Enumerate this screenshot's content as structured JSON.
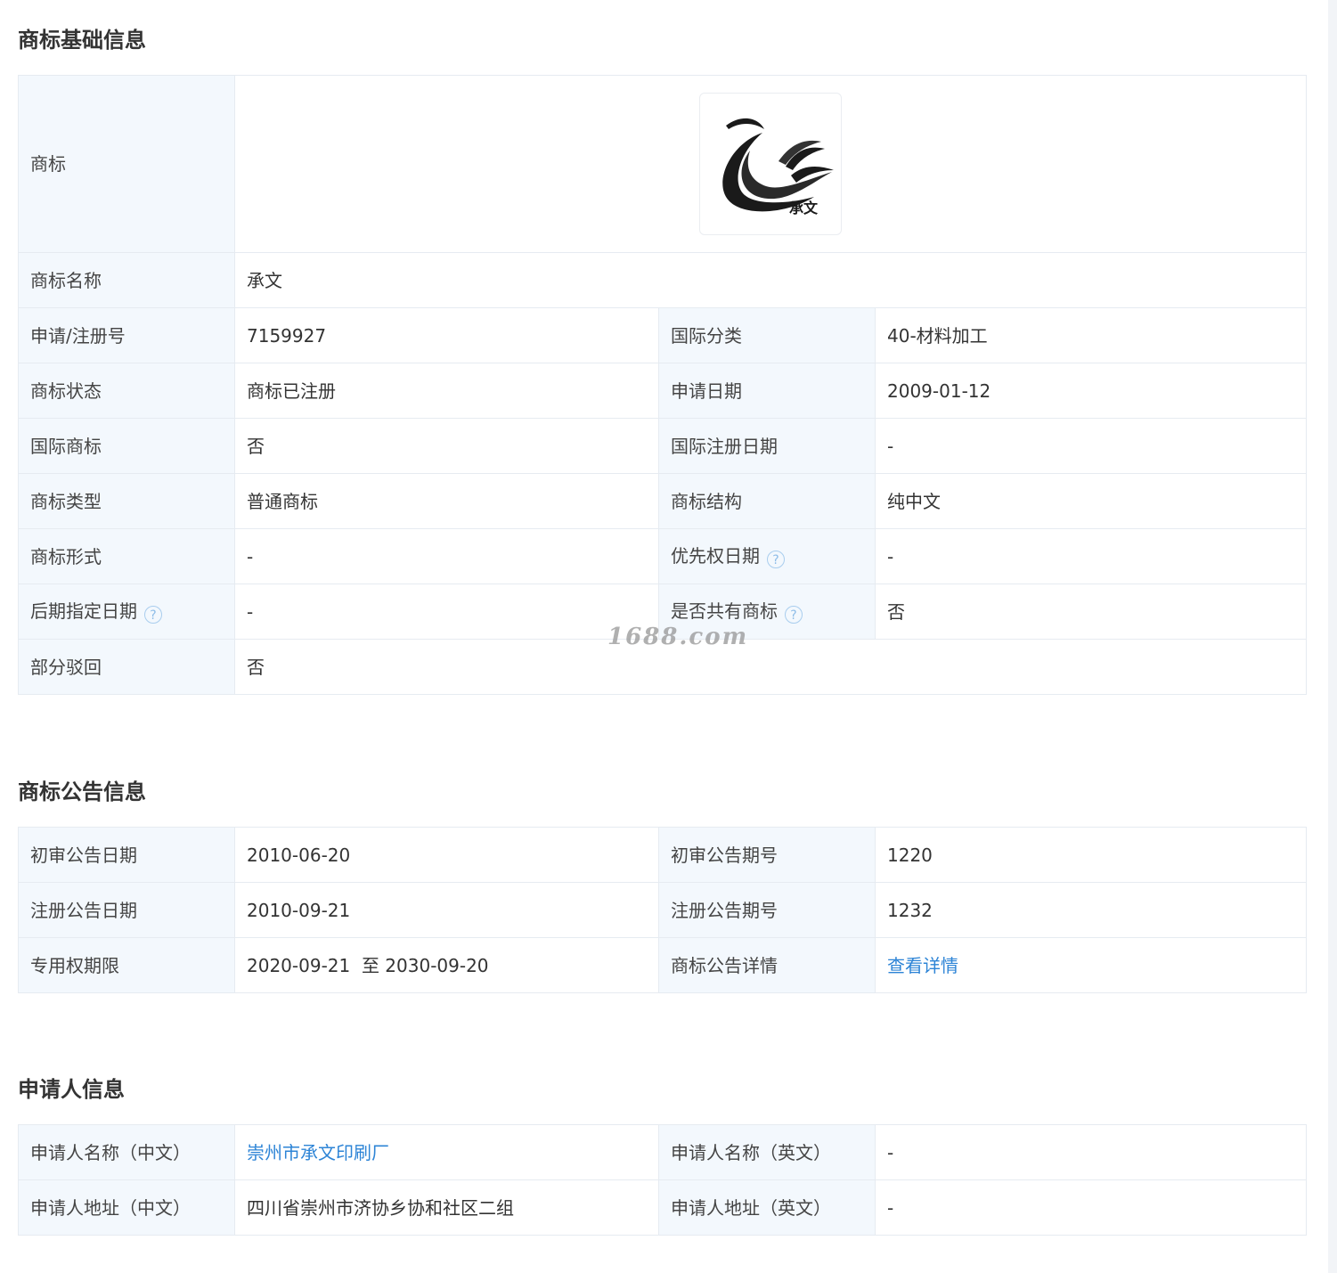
{
  "basic": {
    "title": "商标基础信息",
    "logo_label": "商标",
    "logo_text": "承文",
    "name_label": "商标名称",
    "name_value": "承文",
    "rows": [
      {
        "l1": "申请/注册号",
        "v1": "7159927",
        "l2": "国际分类",
        "v2": "40-材料加工"
      },
      {
        "l1": "商标状态",
        "v1": "商标已注册",
        "l2": "申请日期",
        "v2": "2009-01-12"
      },
      {
        "l1": "国际商标",
        "v1": "否",
        "l2": "国际注册日期",
        "v2": "-"
      },
      {
        "l1": "商标类型",
        "v1": "普通商标",
        "l2": "商标结构",
        "v2": "纯中文"
      },
      {
        "l1": "商标形式",
        "v1": "-",
        "l2": "优先权日期",
        "v2": "-"
      },
      {
        "l1": "后期指定日期",
        "v1": "-",
        "l2": "是否共有商标",
        "v2": "否"
      }
    ],
    "partial_label": "部分驳回",
    "partial_value": "否",
    "help_icon": "?"
  },
  "notice": {
    "title": "商标公告信息",
    "rows": [
      {
        "l1": "初审公告日期",
        "v1": "2010-06-20",
        "l2": "初审公告期号",
        "v2": "1220"
      },
      {
        "l1": "注册公告日期",
        "v1": "2010-09-21",
        "l2": "注册公告期号",
        "v2": "1232"
      },
      {
        "l1": "专用权期限",
        "v1": "2020-09-21  至 2030-09-20",
        "l2": "商标公告详情",
        "v2": "查看详情"
      }
    ]
  },
  "applicant": {
    "title": "申请人信息",
    "rows": [
      {
        "l1": "申请人名称（中文）",
        "v1": "崇州市承文印刷厂",
        "l2": "申请人名称（英文）",
        "v2": "-"
      },
      {
        "l1": "申请人地址（中文）",
        "v1": "四川省崇州市济协乡协和社区二组",
        "l2": "申请人地址（英文）",
        "v2": "-"
      }
    ]
  },
  "watermark": "1688.com",
  "colors": {
    "label_bg": "#f3f8fd",
    "border": "#e6ebf1",
    "link": "#2d84d6"
  }
}
